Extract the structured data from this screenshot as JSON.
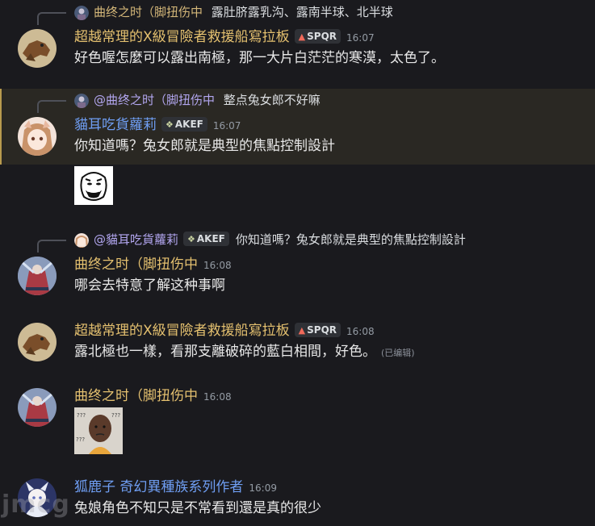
{
  "messages": [
    {
      "reply": {
        "author": "曲终之时（脚扭伤中",
        "content": "露肚脐露乳沟、露南半球、北半球"
      },
      "author": "超越常理的X級冒險者救援船寫拉板",
      "tag": "SPQR",
      "time": "16:07",
      "text": "好色喔怎麼可以露出南極，那一大片白茫茫的寒漠，太色了。"
    },
    {
      "reply": {
        "author": "@曲终之时（脚扭伤中",
        "content": "整点兔女郎不好嘛"
      },
      "author": "貓耳吃貨蘿莉",
      "tag": "AKEF",
      "time": "16:07",
      "text": "你知道嗎？兔女郎就是典型的焦點控制設計",
      "attachment": "meme-face-image"
    },
    {
      "reply": {
        "author": "@貓耳吃貨蘿莉",
        "tag": "AKEF",
        "content": "你知道嗎？兔女郎就是典型的焦點控制設計"
      },
      "author": "曲终之时（脚扭伤中",
      "time": "16:08",
      "text": "哪会去特意了解这种事啊"
    },
    {
      "author": "超越常理的X級冒險者救援船寫拉板",
      "tag": "SPQR",
      "time": "16:08",
      "text": "露北極也一樣，看那支離破碎的藍白相間，好色。",
      "edited": "(已编辑)"
    },
    {
      "author": "曲终之时（脚扭伤中",
      "time": "16:08",
      "attachment": "confused-man-image"
    },
    {
      "author": "狐鹿子 奇幻異種族系列作者",
      "time": "16:09",
      "text": "兔娘角色不知只是不常看到還是真的很少"
    }
  ],
  "watermark": "jmcg",
  "colors": {
    "background": "#1a1a1e",
    "highlight": "#2a2823",
    "highlight_bar": "#b89a4e",
    "name_gold": "#e4c06f",
    "name_blue": "#6f9ef3"
  }
}
